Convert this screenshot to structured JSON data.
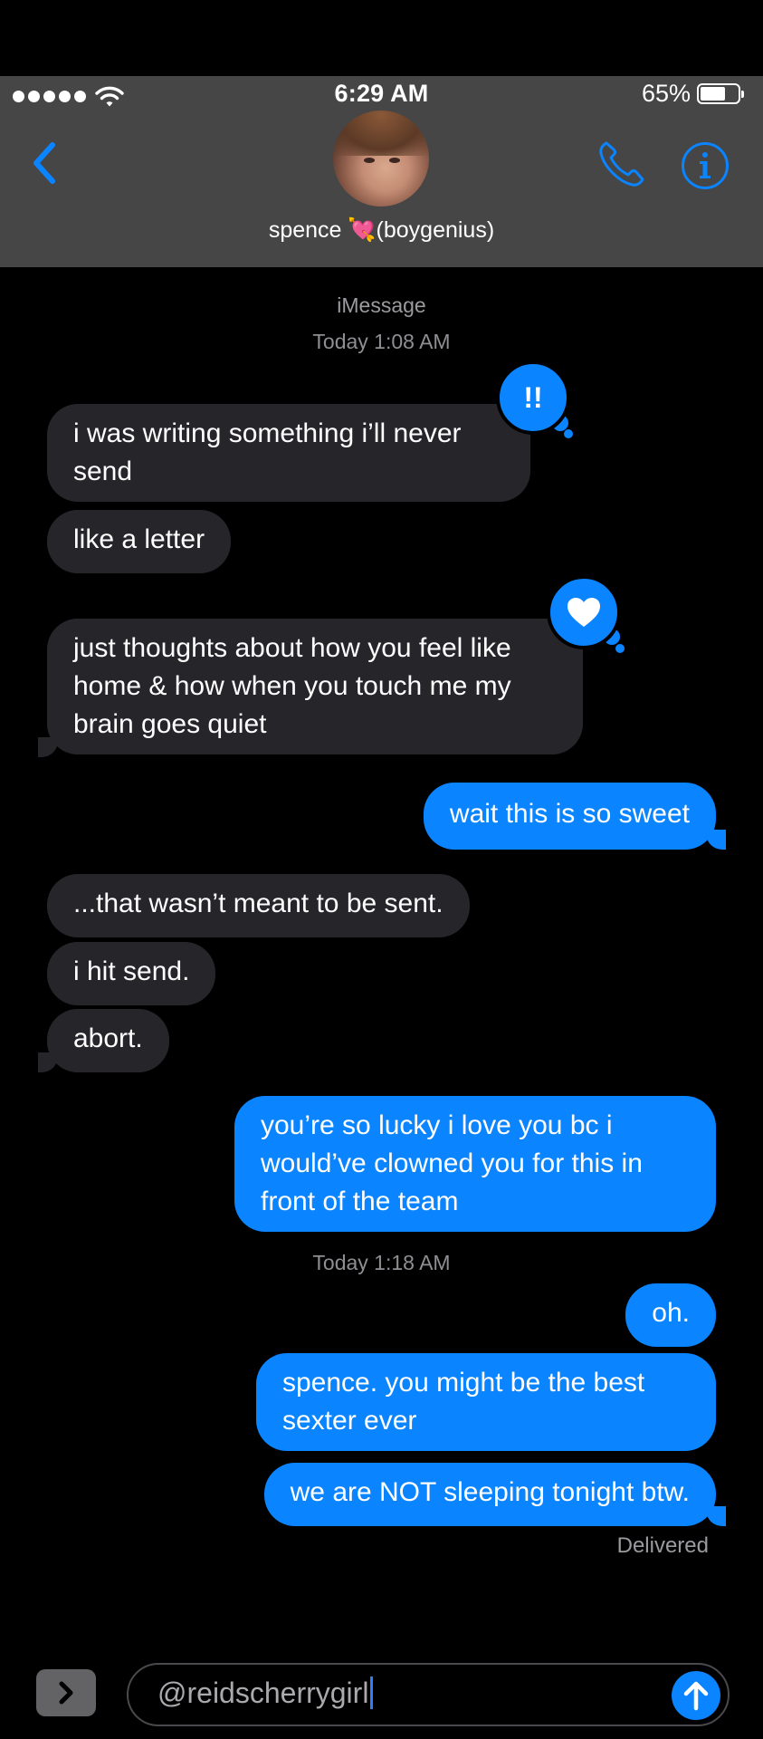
{
  "status_bar": {
    "time": "6:29 AM",
    "battery_percent": "65%",
    "battery_level": 0.65,
    "signal_bars": 5
  },
  "header": {
    "contact_name_prefix": "spence ",
    "contact_name_emoji": "💘",
    "contact_name_suffix": "(boygenius)",
    "back_icon": "chevron-left-icon",
    "call_icon": "phone-icon",
    "info_icon": "info-icon"
  },
  "thread": {
    "service_label": "iMessage",
    "timestamp_1": "Today 1:08 AM",
    "timestamp_2": "Today 1:18 AM",
    "messages": [
      {
        "from": "them",
        "text": "i was writing something i’ll never send",
        "tapback": "!!"
      },
      {
        "from": "them",
        "text": "like a letter"
      },
      {
        "from": "them",
        "text": "just thoughts about how you feel like home & how when you touch me my brain goes quiet",
        "tapback": "heart"
      },
      {
        "from": "me",
        "text": "wait this is so sweet"
      },
      {
        "from": "them",
        "text": "...that wasn’t meant to be sent."
      },
      {
        "from": "them",
        "text": "i hit send."
      },
      {
        "from": "them",
        "text": "abort."
      },
      {
        "from": "me",
        "text": "you’re so lucky i love you bc i would’ve clowned you for this in front of the team"
      },
      {
        "from": "me",
        "text": "oh."
      },
      {
        "from": "me",
        "text": "spence. you might be the best sexter ever"
      },
      {
        "from": "me",
        "text": "we are NOT sleeping tonight btw."
      }
    ],
    "delivered_label": "Delivered"
  },
  "composer": {
    "input_value": "@reidscherrygirl",
    "expand_icon": "chevron-right-icon",
    "send_icon": "arrow-up-icon"
  },
  "colors": {
    "header_bg": "#464646",
    "bubble_in": "#26252a",
    "bubble_out": "#0a84ff",
    "accent": "#0a84ff"
  }
}
